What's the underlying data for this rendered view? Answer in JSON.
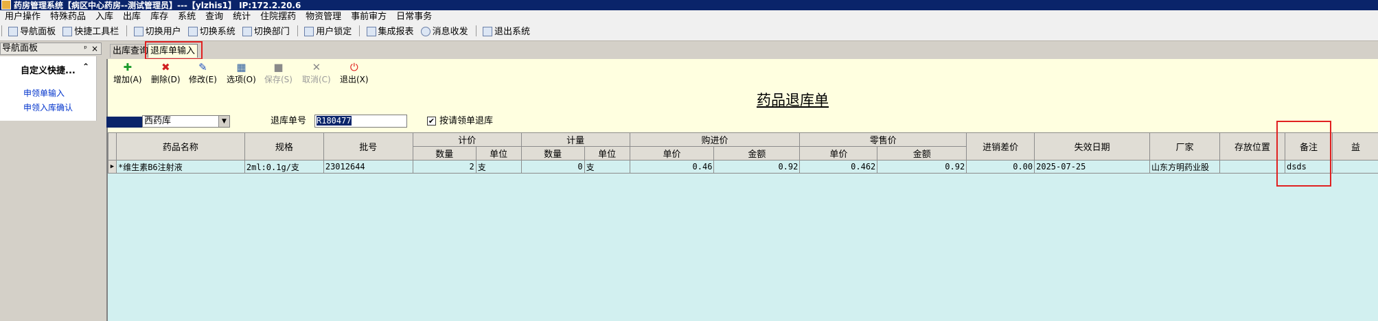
{
  "window": {
    "title": "药房管理系统【病区中心药房--测试管理员】---【ylzhis1】 IP:172.2.20.6"
  },
  "menu": [
    "用户操作",
    "特殊药品",
    "入库",
    "出库",
    "库存",
    "系统",
    "查询",
    "统计",
    "住院摆药",
    "物资管理",
    "事前审方",
    "日常事务"
  ],
  "toolbar": {
    "group1": [
      {
        "label": "导航面板",
        "icon": "nav-panel-icon"
      },
      {
        "label": "快捷工具栏",
        "icon": "shortcut-toolbar-icon"
      }
    ],
    "group2": [
      {
        "label": "切换用户",
        "icon": "switch-user-icon"
      },
      {
        "label": "切换系统",
        "icon": "switch-system-icon"
      },
      {
        "label": "切换部门",
        "icon": "switch-department-icon"
      }
    ],
    "group3": [
      {
        "label": "用户锁定",
        "icon": "lock-user-icon"
      }
    ],
    "group4": [
      {
        "label": "集成报表",
        "icon": "report-icon"
      },
      {
        "label": "消息收发",
        "icon": "message-icon"
      }
    ],
    "group5": [
      {
        "label": "退出系统",
        "icon": "exit-icon"
      }
    ]
  },
  "nav": {
    "header": "导航面板",
    "pin": "ᵖ",
    "close": "×",
    "group_title": "自定义快捷...",
    "collapse": "⌃",
    "links": [
      "申领单输入",
      "申领入库确认"
    ]
  },
  "tabs": [
    "出库查询",
    "退库单输入"
  ],
  "actions": [
    {
      "label": "增加(A)",
      "icon": "add-icon",
      "glyph": "✚",
      "enabled": true
    },
    {
      "label": "删除(D)",
      "icon": "delete-icon",
      "glyph": "✖",
      "enabled": true
    },
    {
      "label": "修改(E)",
      "icon": "edit-icon",
      "glyph": "✎",
      "enabled": true
    },
    {
      "label": "选项(O)",
      "icon": "options-icon",
      "glyph": "▦",
      "enabled": true
    },
    {
      "label": "保存(S)",
      "icon": "save-icon",
      "glyph": "■",
      "enabled": false
    },
    {
      "label": "取消(C)",
      "icon": "cancel-icon",
      "glyph": "✕",
      "enabled": false
    },
    {
      "label": "退出(X)",
      "icon": "power-icon",
      "glyph": "⏻",
      "enabled": true
    }
  ],
  "form": {
    "title": "药品退库单",
    "warehouse": "西药库",
    "return_no_label": "退库单号",
    "return_no": "R180477",
    "checkbox_checked": true,
    "checkbox_label": "按请领单退库"
  },
  "grid": {
    "headers": {
      "name": "药品名称",
      "spec": "规格",
      "batch": "批号",
      "price_unit_group": "计价",
      "qty_group": "计量",
      "purchase_group": "购进价",
      "retail_group": "零售价",
      "diff": "进销差价",
      "expiry": "失效日期",
      "maker": "厂家",
      "location": "存放位置",
      "remark": "备注",
      "extra": "益",
      "sub": {
        "qty": "数量",
        "unit": "单位",
        "qty2": "数量",
        "unit2": "单位",
        "p_price": "单价",
        "p_amount": "金额",
        "r_price": "单价",
        "r_amount": "金额"
      }
    },
    "rows": [
      {
        "name": "*维生素B6注射液",
        "spec": "2ml:0.1g/支",
        "batch": "23012644",
        "qty": "2",
        "unit": "支",
        "qty2": "0",
        "unit2": "支",
        "p_price": "0.46",
        "p_amount": "0.92",
        "r_price": "0.462",
        "r_amount": "0.92",
        "diff": "0.00",
        "expiry": "2025-07-25",
        "maker": "山东方明药业股",
        "location": "",
        "remark": "dsds"
      }
    ]
  }
}
